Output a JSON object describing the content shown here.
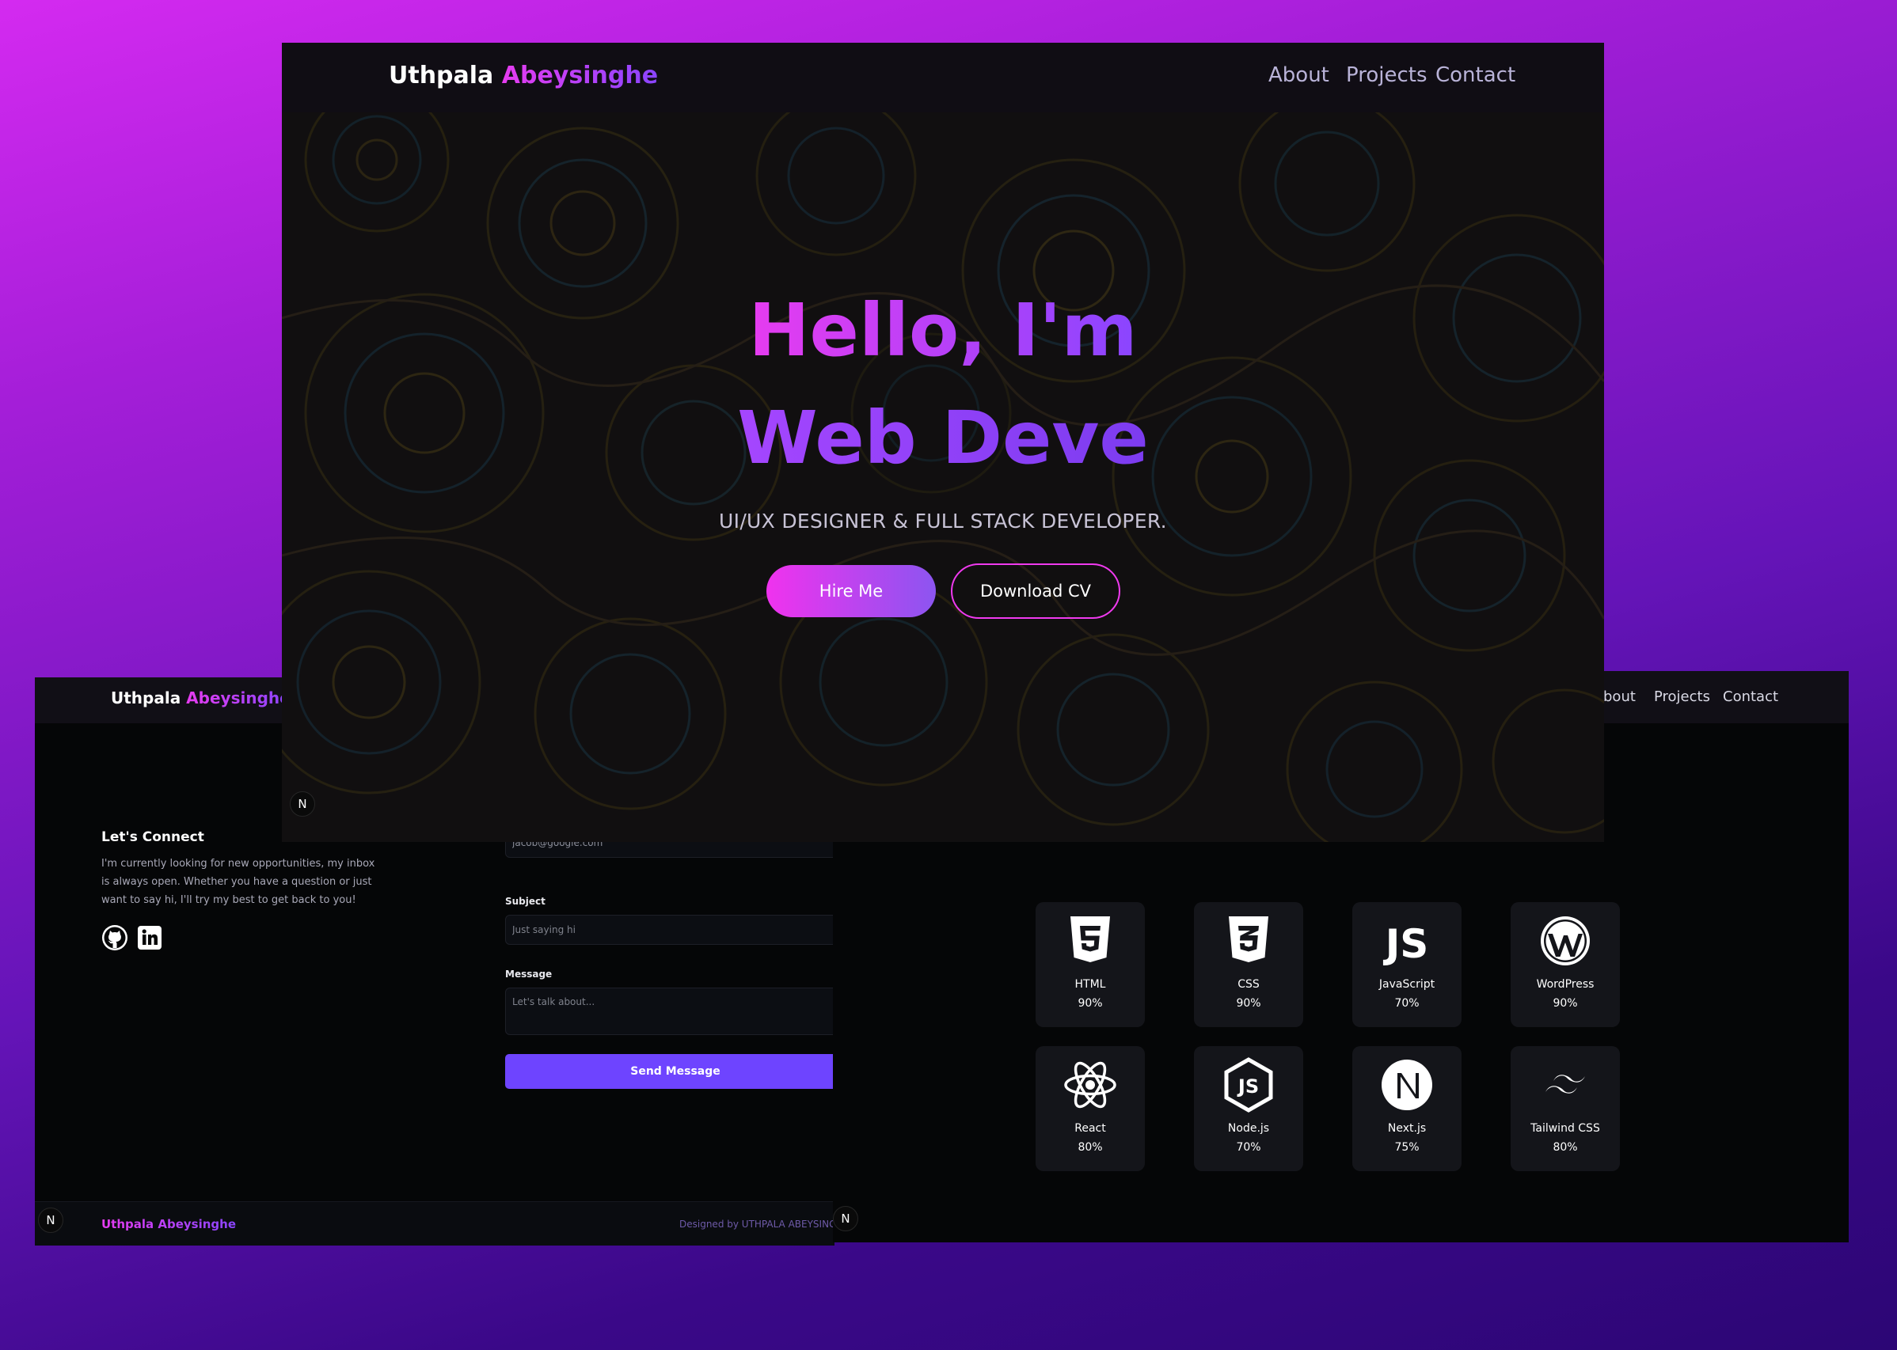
{
  "brand": {
    "first": "Uthpala",
    "last": "Abeysinghe"
  },
  "hero_window": {
    "nav": [
      "About",
      "Projects",
      "Contact"
    ],
    "headline_1": "Hello, I'm",
    "headline_2": "Web Deve",
    "subtitle": "UI/UX DESIGNER & FULL STACK DEVELOPER.",
    "hire_button": "Hire Me",
    "cv_button": "Download CV",
    "badge": "N"
  },
  "contact_window": {
    "connect_title": "Let's Connect",
    "connect_text": "I'm currently looking for new opportunities, my inbox is always open. Whether you have a question or just want to say hi, I'll try my best to get back to you!",
    "social_icons": [
      "github-icon",
      "linkedin-icon"
    ],
    "email_value": "jacob@google.com",
    "subject_label": "Subject",
    "subject_placeholder": "Just saying hi",
    "message_label": "Message",
    "message_placeholder": "Let's talk about...",
    "send_button": "Send Message",
    "footer_brand": "Uthpala Abeysinghe",
    "footer_credit": "Designed by UTHPALA ABEYSINGHE || A",
    "badge": "N"
  },
  "skills_window": {
    "nav": [
      "bout",
      "Projects",
      "Contact"
    ],
    "badge": "N",
    "skills": [
      {
        "name": "HTML",
        "percent": "90%",
        "icon": "html5-icon"
      },
      {
        "name": "CSS",
        "percent": "90%",
        "icon": "css3-icon"
      },
      {
        "name": "JavaScript",
        "percent": "70%",
        "icon": "javascript-icon"
      },
      {
        "name": "WordPress",
        "percent": "90%",
        "icon": "wordpress-icon"
      },
      {
        "name": "React",
        "percent": "80%",
        "icon": "react-icon"
      },
      {
        "name": "Node.js",
        "percent": "70%",
        "icon": "nodejs-icon"
      },
      {
        "name": "Next.js",
        "percent": "75%",
        "icon": "nextjs-icon"
      },
      {
        "name": "Tailwind CSS",
        "percent": "80%",
        "icon": "tailwind-icon"
      }
    ]
  },
  "colors": {
    "accent_pink": "#e63cf0",
    "accent_purple": "#8a45ff",
    "button_purple": "#6e44ff",
    "page_gradient_top": "#d42af0",
    "page_gradient_bottom": "#2c0675"
  }
}
